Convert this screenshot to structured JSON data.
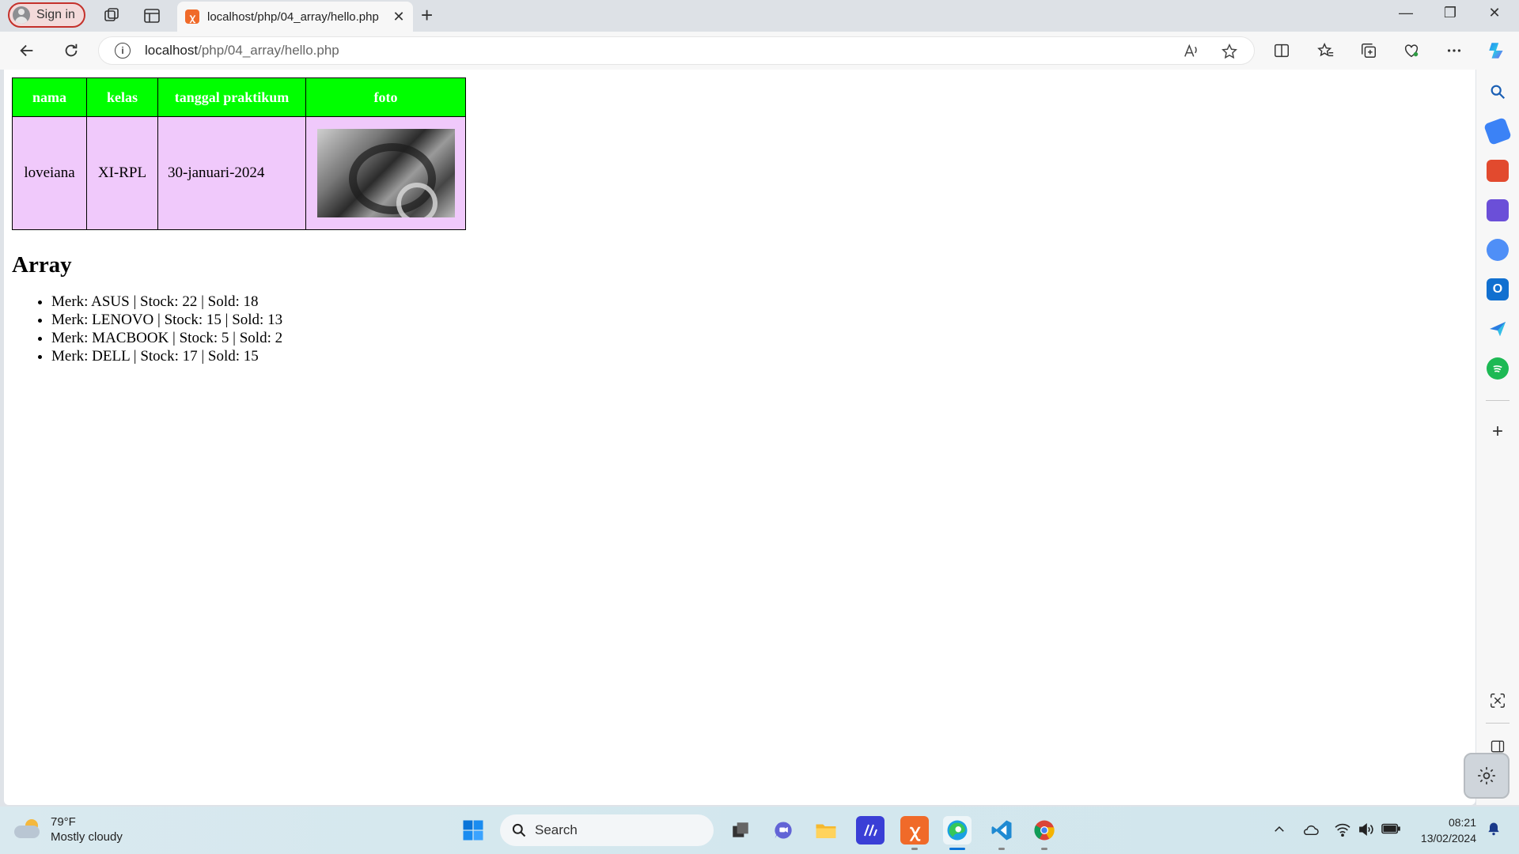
{
  "browser": {
    "signin_label": "Sign in",
    "tab_title": "localhost/php/04_array/hello.php",
    "tab_favicon": "xampp-icon",
    "new_tab_glyph": "+",
    "tab_close_glyph": "✕",
    "url_host": "localhost",
    "url_path": "/php/04_array/hello.php",
    "info_glyph": "i",
    "window_controls": {
      "minimize": "—",
      "restore": "❐",
      "close": "✕"
    }
  },
  "table": {
    "headers": [
      "nama",
      "kelas",
      "tanggal praktikum",
      "foto"
    ],
    "row": {
      "nama": "loveiana",
      "kelas": "XI-RPL",
      "tanggal": "30-januari-2024"
    },
    "header_color": "#00ff00",
    "cell_color": "#f0c9fb"
  },
  "array_section": {
    "heading": "Array",
    "items": [
      "Merk: ASUS | Stock: 22 | Sold: 18",
      "Merk: LENOVO | Stock: 15 | Sold: 13",
      "Merk: MACBOOK | Stock: 5 | Sold: 2",
      "Merk: DELL | Stock: 17 | Sold: 15"
    ]
  },
  "taskbar": {
    "weather_temp": "79°F",
    "weather_desc": "Mostly cloudy",
    "search_label": "Search",
    "time": "08:21",
    "date": "13/02/2024"
  }
}
